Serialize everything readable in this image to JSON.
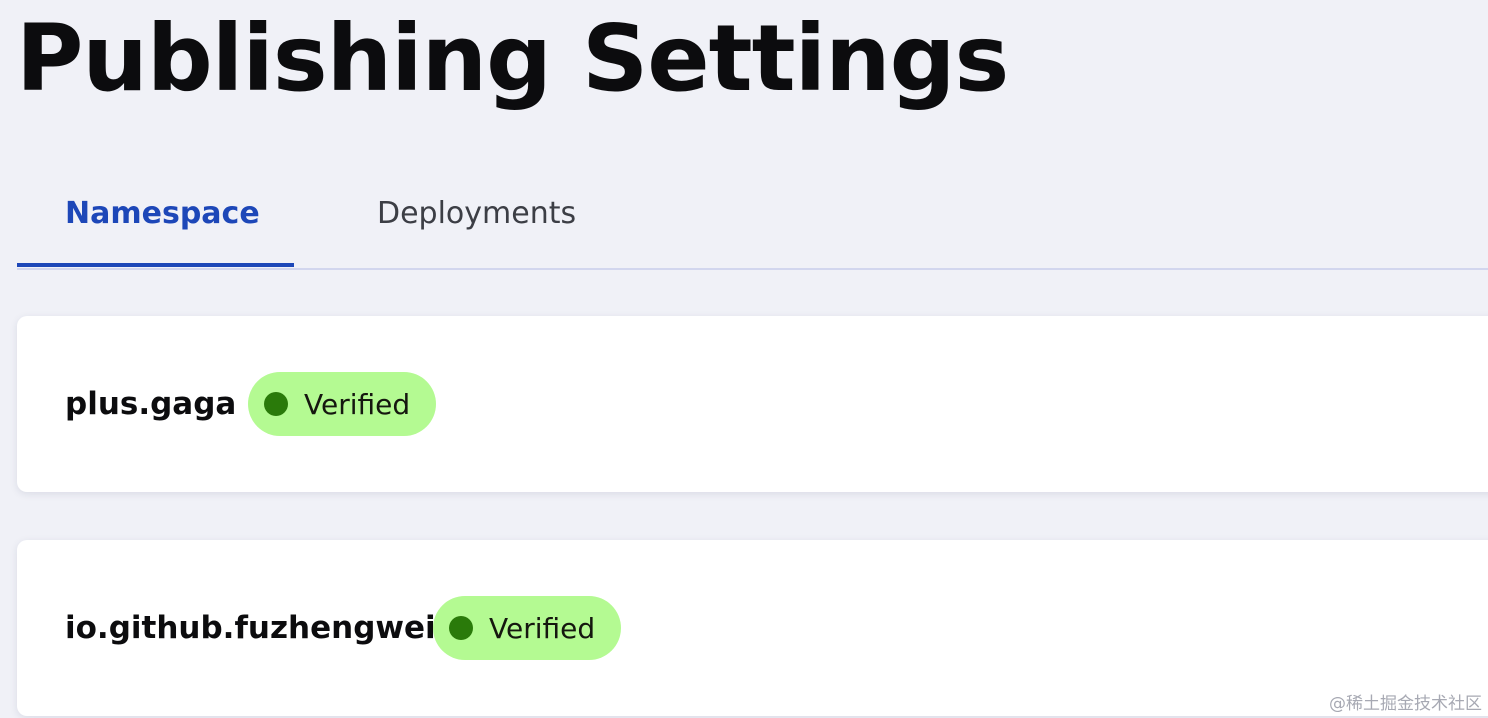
{
  "page": {
    "title": "Publishing Settings"
  },
  "tabs": [
    {
      "label": "Namespace",
      "active": true
    },
    {
      "label": "Deployments",
      "active": false
    }
  ],
  "namespaces": [
    {
      "name": "plus.gaga",
      "status": "Verified"
    },
    {
      "name": "io.github.fuzhengwei",
      "status": "Verified"
    }
  ],
  "watermark": "@稀土掘金技术社区",
  "colors": {
    "background": "#f0f1f7",
    "accent": "#1d47b8",
    "badge_background": "#b4fa92",
    "badge_dot": "#2a7a0a",
    "card_background": "#ffffff"
  }
}
